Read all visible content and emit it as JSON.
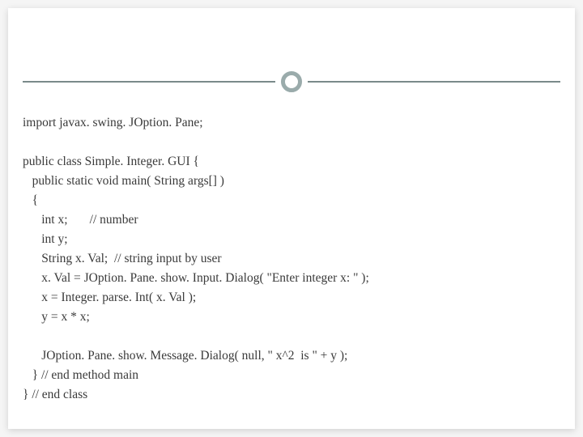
{
  "code": {
    "l01": "import javax. swing. JOption. Pane;",
    "l02": "public class Simple. Integer. GUI {",
    "l03": "   public static void main( String args[] )",
    "l04": "   {",
    "l05": "      int x;       // number",
    "l06": "      int y;",
    "l07": "      String x. Val;  // string input by user",
    "l08": "      x. Val = JOption. Pane. show. Input. Dialog( \"Enter integer x: \" );",
    "l09": "      x = Integer. parse. Int( x. Val );",
    "l10": "      y = x * x;",
    "l11": "      JOption. Pane. show. Message. Dialog( null, \" x^2  is \" + y );",
    "l12": "   } // end method main",
    "l13": "} // end class"
  }
}
